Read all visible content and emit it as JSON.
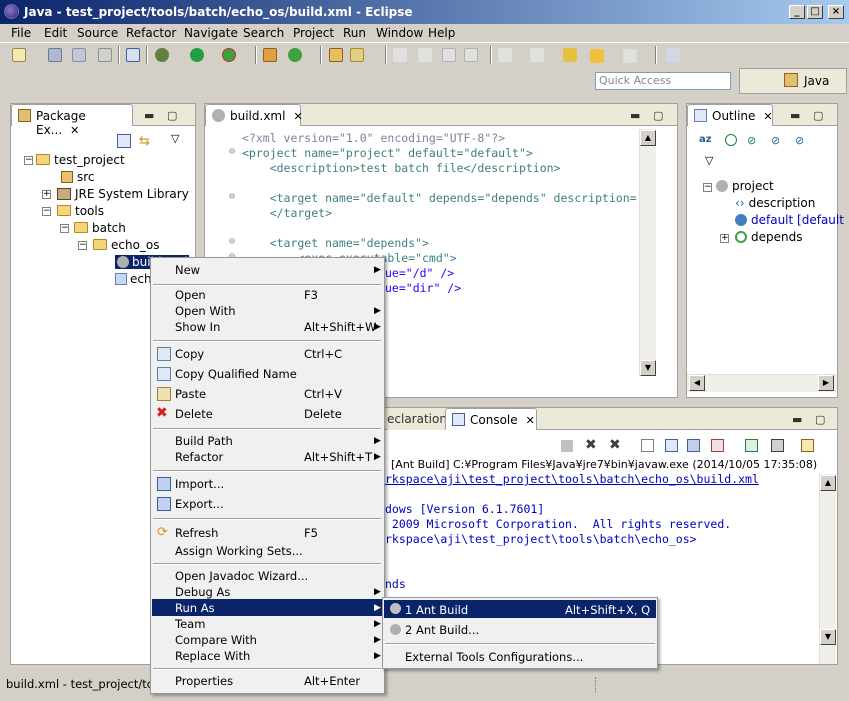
{
  "window": {
    "title": "Java - test_project/tools/batch/echo_os/build.xml - Eclipse"
  },
  "menubar": [
    "File",
    "Edit",
    "Source",
    "Refactor",
    "Navigate",
    "Search",
    "Project",
    "Run",
    "Window",
    "Help"
  ],
  "toolbar": {
    "quick_access_placeholder": "Quick Access",
    "perspective_label": "Java"
  },
  "package_explorer": {
    "tab_label": "Package Ex...",
    "tree": [
      {
        "label": "test_project"
      },
      {
        "label": "src"
      },
      {
        "label": "JRE System Library"
      },
      {
        "label": "tools"
      },
      {
        "label": "batch"
      },
      {
        "label": "echo_os"
      },
      {
        "label": "build.xml"
      },
      {
        "label": "echo"
      }
    ]
  },
  "editor": {
    "tab_label": "build.xml",
    "lines": [
      "<?xml version=\"1.0\" encoding=\"UTF-8\"?>",
      "<project name=\"project\" default=\"default\">",
      "    <description>test batch file</description>",
      "",
      "    <target name=\"default\" depends=\"depends\" description=",
      "    </target>",
      "",
      "    <target name=\"depends\">",
      "        <exec executable=\"cmd\">",
      "ue=\"/d\" />",
      "ue=\"dir\" />"
    ]
  },
  "outline": {
    "tab_label": "Outline",
    "items": [
      "project",
      "description",
      "default [default",
      "depends"
    ]
  },
  "console": {
    "tabs": {
      "declaration": "eclaration",
      "console": "Console"
    },
    "header": "[Ant Build] C:¥Program Files¥Java¥jre7¥bin¥javaw.exe (2014/10/05 17:35:08)",
    "lines": [
      "rkspace\\aji\\test_project\\tools\\batch\\echo_os\\build.xml",
      "",
      "dows [Version 6.1.7601]",
      " 2009 Microsoft Corporation.  All rights reserved.",
      "rkspace\\aji\\test_project\\tools\\batch\\echo_os>",
      "",
      "",
      "nds"
    ]
  },
  "context_menu": {
    "items": [
      {
        "label": "New",
        "submenu": true
      },
      {
        "label": "Open",
        "accel": "F3"
      },
      {
        "label": "Open With",
        "submenu": true
      },
      {
        "label": "Show In",
        "accel": "Alt+Shift+W",
        "submenu": true
      },
      {
        "label": "Copy",
        "accel": "Ctrl+C"
      },
      {
        "label": "Copy Qualified Name"
      },
      {
        "label": "Paste",
        "accel": "Ctrl+V"
      },
      {
        "label": "Delete",
        "accel": "Delete"
      },
      {
        "label": "Build Path",
        "submenu": true
      },
      {
        "label": "Refactor",
        "accel": "Alt+Shift+T",
        "submenu": true
      },
      {
        "label": "Import..."
      },
      {
        "label": "Export..."
      },
      {
        "label": "Refresh",
        "accel": "F5"
      },
      {
        "label": "Assign Working Sets..."
      },
      {
        "label": "Open Javadoc Wizard..."
      },
      {
        "label": "Debug As",
        "submenu": true
      },
      {
        "label": "Run As",
        "submenu": true,
        "highlighted": true
      },
      {
        "label": "Team",
        "submenu": true
      },
      {
        "label": "Compare With",
        "submenu": true
      },
      {
        "label": "Replace With",
        "submenu": true
      },
      {
        "label": "Properties",
        "accel": "Alt+Enter"
      }
    ]
  },
  "run_as_submenu": {
    "items": [
      {
        "label": "1 Ant Build",
        "accel": "Alt+Shift+X, Q",
        "highlighted": true
      },
      {
        "label": "2 Ant Build..."
      },
      {
        "label": "External Tools Configurations..."
      }
    ]
  },
  "statusbar": {
    "text": "build.xml - test_project/tool"
  },
  "colors": {
    "selection": "#0a246a",
    "title_start": "#0a246a",
    "title_end": "#a6caf0"
  },
  "icons": [
    "eclipse-icon",
    "ant-icon",
    "folder-icon",
    "package-icon",
    "library-icon",
    "outline-element-icon"
  ]
}
